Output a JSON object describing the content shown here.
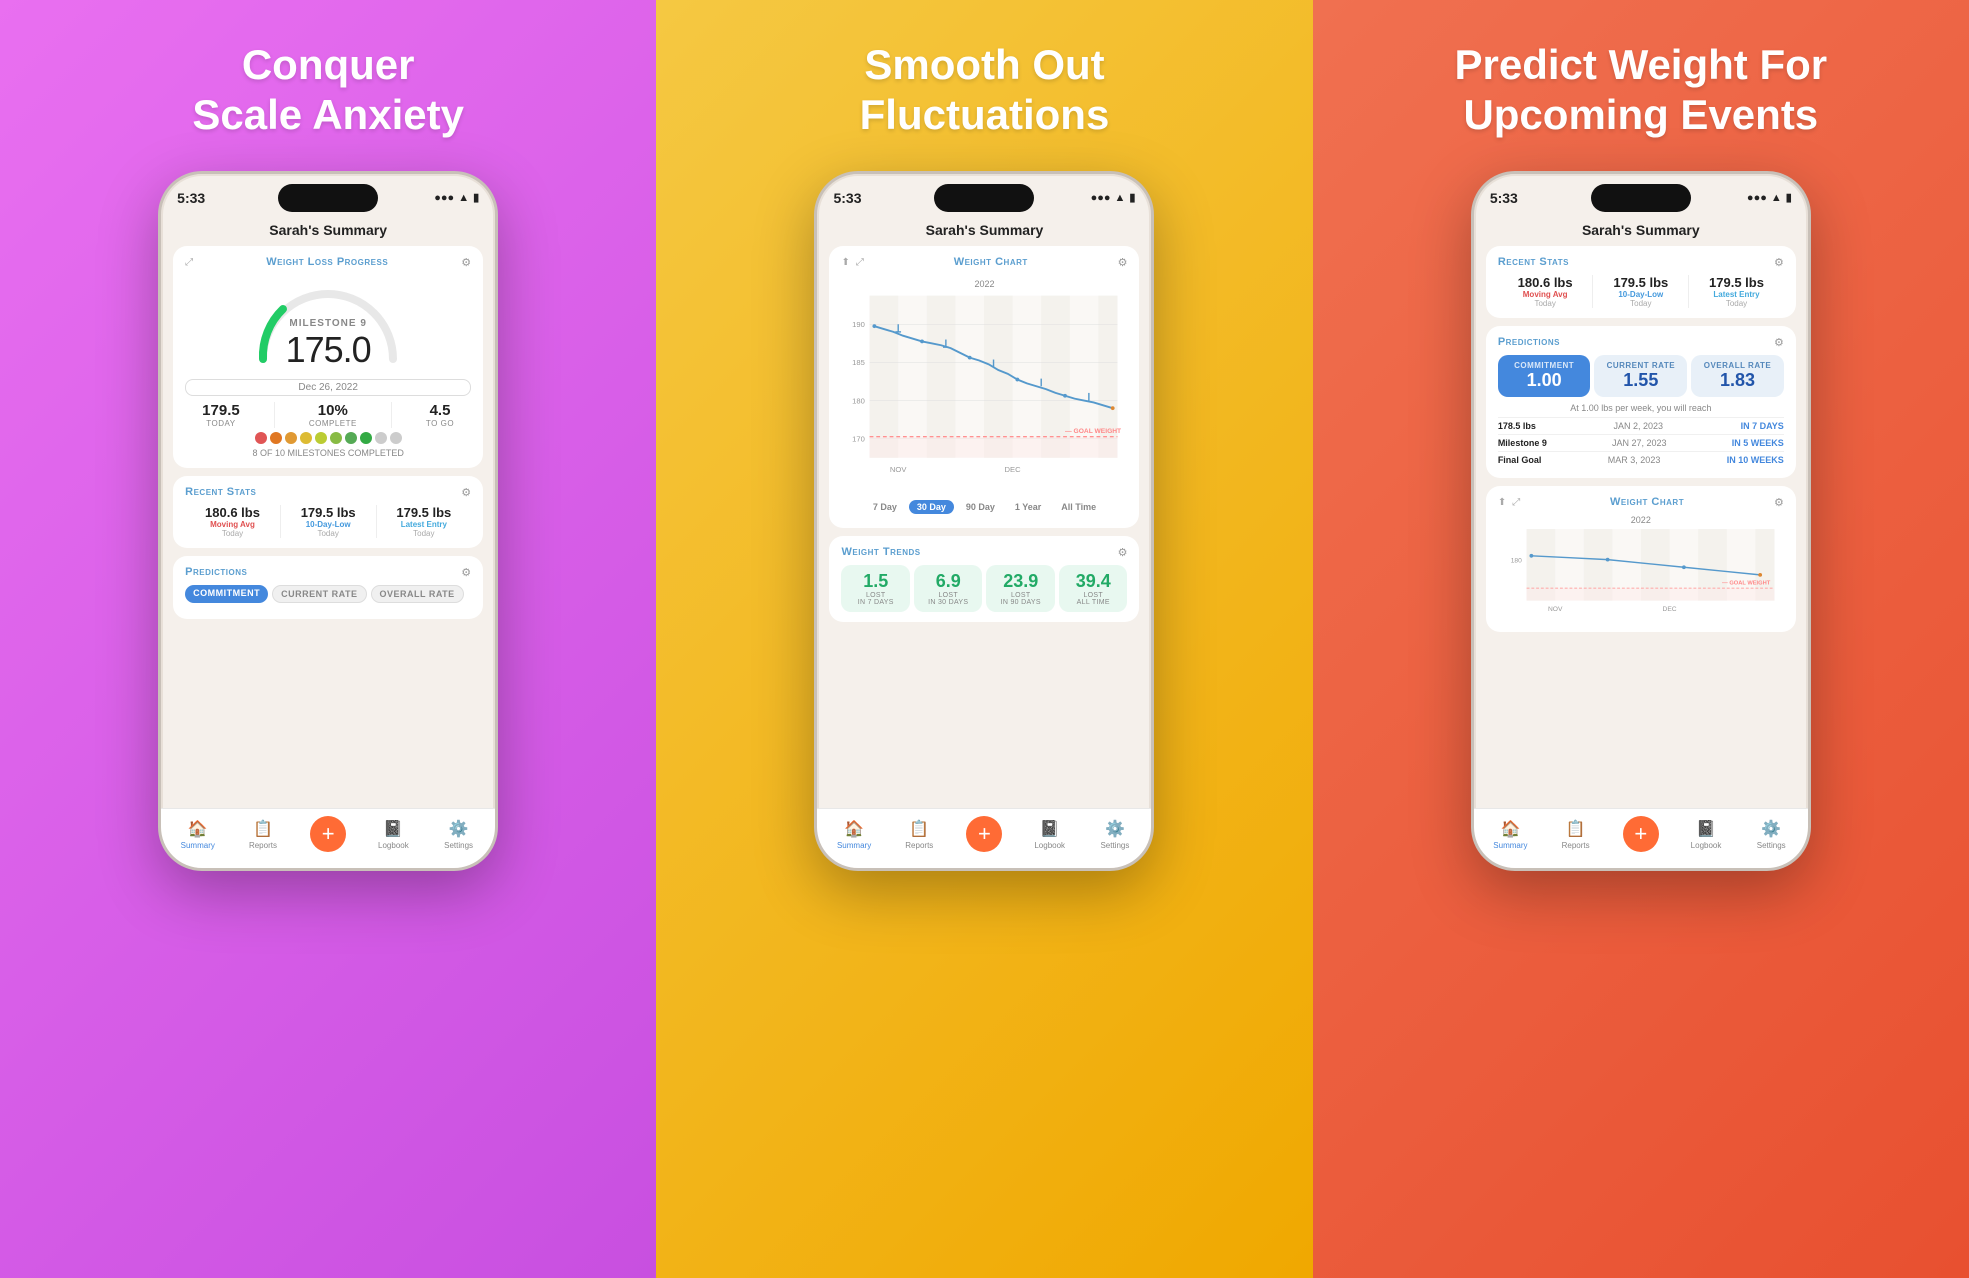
{
  "panels": [
    {
      "id": "panel-1",
      "title": "Conquer\nScale Anxiety",
      "bgFrom": "#e96ff0",
      "bgTo": "#c84fe0"
    },
    {
      "id": "panel-2",
      "title": "Smooth Out\nFluctuations",
      "bgFrom": "#f5c842",
      "bgTo": "#f0a800"
    },
    {
      "id": "panel-3",
      "title": "Predict Weight For\nUpcoming Events",
      "bgFrom": "#f07050",
      "bgTo": "#e85030"
    }
  ],
  "phone1": {
    "time": "5:33",
    "screenTitle": "Sarah's Summary",
    "weightProgress": {
      "sectionTitle": "Weight Loss Progress",
      "milestone": "MILESTONE 9",
      "weight": "175.0",
      "date": "Dec 26, 2022",
      "today": "179.5",
      "todayLabel": "TODAY",
      "complete": "10%",
      "completeLabel": "COMPLETE",
      "toGo": "4.5",
      "toGoLabel": "TO GO",
      "milestonesText": "8 OF 10 MILESTONES COMPLETED"
    },
    "recentStats": {
      "sectionTitle": "Recent Stats",
      "stats": [
        {
          "value": "180.6 lbs",
          "sub": "Moving Avg",
          "date": "Today"
        },
        {
          "value": "179.5 lbs",
          "sub": "10-Day-Low",
          "date": "Today"
        },
        {
          "value": "179.5 lbs",
          "sub": "Latest Entry",
          "date": "Today"
        }
      ]
    },
    "predictions": {
      "sectionTitle": "Predictions",
      "badges": [
        "COMMITMENT",
        "CURRENT RATE",
        "OVERALL RATE"
      ]
    },
    "nav": {
      "items": [
        {
          "label": "Summary",
          "active": true,
          "icon": "📊"
        },
        {
          "label": "Reports",
          "active": false,
          "icon": "📋"
        },
        {
          "label": "+",
          "active": false,
          "icon": "+"
        },
        {
          "label": "Logbook",
          "active": false,
          "icon": "📓"
        },
        {
          "label": "Settings",
          "active": false,
          "icon": "⚙️"
        }
      ]
    }
  },
  "phone2": {
    "time": "5:33",
    "screenTitle": "Sarah's Summary",
    "weightChart": {
      "sectionTitle": "Weight Chart",
      "year": "2022",
      "months": [
        "NOV",
        "DEC"
      ],
      "tabs": [
        "7 Day",
        "30 Day",
        "90 Day",
        "1 Year",
        "All Time"
      ],
      "activeTab": "30 Day"
    },
    "weightTrends": {
      "sectionTitle": "Weight Trends",
      "items": [
        {
          "value": "1.5",
          "label": "LOST\nIN 7 DAYS"
        },
        {
          "value": "6.9",
          "label": "LOST\nIN 30 DAYS"
        },
        {
          "value": "23.9",
          "label": "LOST\nIN 90 DAYS"
        },
        {
          "value": "39.4",
          "label": "LOST\nALL TIME"
        }
      ]
    }
  },
  "phone3": {
    "time": "5:33",
    "screenTitle": "Sarah's Summary",
    "recentStats": {
      "sectionTitle": "Recent Stats",
      "stats": [
        {
          "value": "180.6 lbs",
          "sub": "Moving Avg",
          "date": "Today"
        },
        {
          "value": "179.5 lbs",
          "sub": "10-Day-Low",
          "date": "Today"
        },
        {
          "value": "179.5 lbs",
          "sub": "Latest Entry",
          "date": "Today"
        }
      ]
    },
    "predictions": {
      "sectionTitle": "Predictions",
      "commitment": {
        "label": "COMMITMENT",
        "value": "1.00"
      },
      "currentRate": {
        "label": "CURRENT RATE",
        "value": "1.55"
      },
      "overallRate": {
        "label": "OVERALL RATE",
        "value": "1.83"
      },
      "atText": "At 1.00 lbs per week, you will reach",
      "rows": [
        {
          "weight": "178.5 lbs",
          "date": "JAN 2, 2023",
          "days": "IN 7 DAYS"
        },
        {
          "weight": "Milestone 9",
          "date": "JAN 27, 2023",
          "days": "IN 5 WEEKS"
        },
        {
          "weight": "Final Goal",
          "date": "MAR 3, 2023",
          "days": "IN 10 WEEKS"
        }
      ]
    },
    "weightChart": {
      "sectionTitle": "Weight Chart",
      "year": "2022",
      "months": [
        "NOV",
        "DEC"
      ]
    }
  }
}
